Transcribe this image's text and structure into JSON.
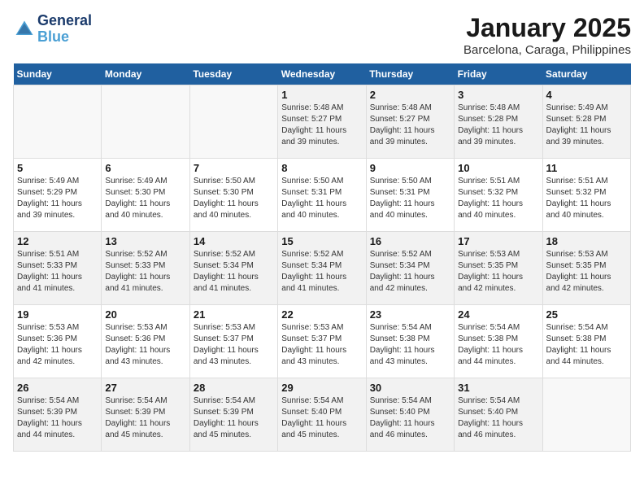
{
  "header": {
    "logo_line1": "General",
    "logo_line2": "Blue",
    "title": "January 2025",
    "subtitle": "Barcelona, Caraga, Philippines"
  },
  "calendar": {
    "days_of_week": [
      "Sunday",
      "Monday",
      "Tuesday",
      "Wednesday",
      "Thursday",
      "Friday",
      "Saturday"
    ],
    "weeks": [
      [
        {
          "day": "",
          "info": ""
        },
        {
          "day": "",
          "info": ""
        },
        {
          "day": "",
          "info": ""
        },
        {
          "day": "1",
          "info": "Sunrise: 5:48 AM\nSunset: 5:27 PM\nDaylight: 11 hours\nand 39 minutes."
        },
        {
          "day": "2",
          "info": "Sunrise: 5:48 AM\nSunset: 5:27 PM\nDaylight: 11 hours\nand 39 minutes."
        },
        {
          "day": "3",
          "info": "Sunrise: 5:48 AM\nSunset: 5:28 PM\nDaylight: 11 hours\nand 39 minutes."
        },
        {
          "day": "4",
          "info": "Sunrise: 5:49 AM\nSunset: 5:28 PM\nDaylight: 11 hours\nand 39 minutes."
        }
      ],
      [
        {
          "day": "5",
          "info": "Sunrise: 5:49 AM\nSunset: 5:29 PM\nDaylight: 11 hours\nand 39 minutes."
        },
        {
          "day": "6",
          "info": "Sunrise: 5:49 AM\nSunset: 5:30 PM\nDaylight: 11 hours\nand 40 minutes."
        },
        {
          "day": "7",
          "info": "Sunrise: 5:50 AM\nSunset: 5:30 PM\nDaylight: 11 hours\nand 40 minutes."
        },
        {
          "day": "8",
          "info": "Sunrise: 5:50 AM\nSunset: 5:31 PM\nDaylight: 11 hours\nand 40 minutes."
        },
        {
          "day": "9",
          "info": "Sunrise: 5:50 AM\nSunset: 5:31 PM\nDaylight: 11 hours\nand 40 minutes."
        },
        {
          "day": "10",
          "info": "Sunrise: 5:51 AM\nSunset: 5:32 PM\nDaylight: 11 hours\nand 40 minutes."
        },
        {
          "day": "11",
          "info": "Sunrise: 5:51 AM\nSunset: 5:32 PM\nDaylight: 11 hours\nand 40 minutes."
        }
      ],
      [
        {
          "day": "12",
          "info": "Sunrise: 5:51 AM\nSunset: 5:33 PM\nDaylight: 11 hours\nand 41 minutes."
        },
        {
          "day": "13",
          "info": "Sunrise: 5:52 AM\nSunset: 5:33 PM\nDaylight: 11 hours\nand 41 minutes."
        },
        {
          "day": "14",
          "info": "Sunrise: 5:52 AM\nSunset: 5:34 PM\nDaylight: 11 hours\nand 41 minutes."
        },
        {
          "day": "15",
          "info": "Sunrise: 5:52 AM\nSunset: 5:34 PM\nDaylight: 11 hours\nand 41 minutes."
        },
        {
          "day": "16",
          "info": "Sunrise: 5:52 AM\nSunset: 5:34 PM\nDaylight: 11 hours\nand 42 minutes."
        },
        {
          "day": "17",
          "info": "Sunrise: 5:53 AM\nSunset: 5:35 PM\nDaylight: 11 hours\nand 42 minutes."
        },
        {
          "day": "18",
          "info": "Sunrise: 5:53 AM\nSunset: 5:35 PM\nDaylight: 11 hours\nand 42 minutes."
        }
      ],
      [
        {
          "day": "19",
          "info": "Sunrise: 5:53 AM\nSunset: 5:36 PM\nDaylight: 11 hours\nand 42 minutes."
        },
        {
          "day": "20",
          "info": "Sunrise: 5:53 AM\nSunset: 5:36 PM\nDaylight: 11 hours\nand 43 minutes."
        },
        {
          "day": "21",
          "info": "Sunrise: 5:53 AM\nSunset: 5:37 PM\nDaylight: 11 hours\nand 43 minutes."
        },
        {
          "day": "22",
          "info": "Sunrise: 5:53 AM\nSunset: 5:37 PM\nDaylight: 11 hours\nand 43 minutes."
        },
        {
          "day": "23",
          "info": "Sunrise: 5:54 AM\nSunset: 5:38 PM\nDaylight: 11 hours\nand 43 minutes."
        },
        {
          "day": "24",
          "info": "Sunrise: 5:54 AM\nSunset: 5:38 PM\nDaylight: 11 hours\nand 44 minutes."
        },
        {
          "day": "25",
          "info": "Sunrise: 5:54 AM\nSunset: 5:38 PM\nDaylight: 11 hours\nand 44 minutes."
        }
      ],
      [
        {
          "day": "26",
          "info": "Sunrise: 5:54 AM\nSunset: 5:39 PM\nDaylight: 11 hours\nand 44 minutes."
        },
        {
          "day": "27",
          "info": "Sunrise: 5:54 AM\nSunset: 5:39 PM\nDaylight: 11 hours\nand 45 minutes."
        },
        {
          "day": "28",
          "info": "Sunrise: 5:54 AM\nSunset: 5:39 PM\nDaylight: 11 hours\nand 45 minutes."
        },
        {
          "day": "29",
          "info": "Sunrise: 5:54 AM\nSunset: 5:40 PM\nDaylight: 11 hours\nand 45 minutes."
        },
        {
          "day": "30",
          "info": "Sunrise: 5:54 AM\nSunset: 5:40 PM\nDaylight: 11 hours\nand 46 minutes."
        },
        {
          "day": "31",
          "info": "Sunrise: 5:54 AM\nSunset: 5:40 PM\nDaylight: 11 hours\nand 46 minutes."
        },
        {
          "day": "",
          "info": ""
        }
      ]
    ]
  }
}
